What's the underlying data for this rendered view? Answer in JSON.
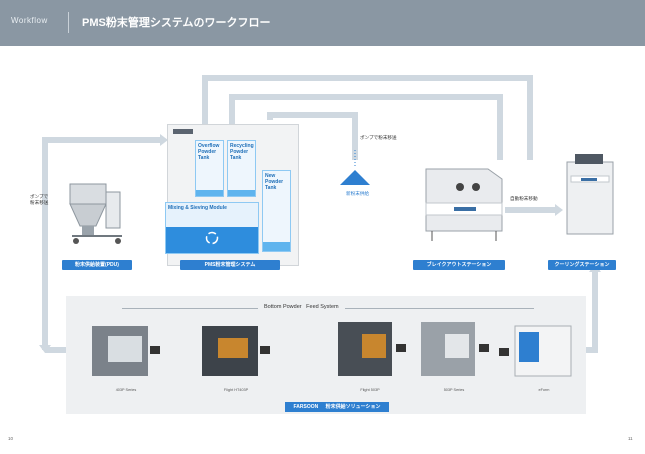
{
  "header": {
    "tag": "Workflow",
    "title": "PMS粉末管理システムのワークフロー"
  },
  "labels": {
    "pump_left": "ポンプで\n粉末移送",
    "pump_top": "ポンプで粉末移送",
    "pump_right": "自動粉末移動",
    "new_powder": "新粉末供給"
  },
  "tanks": {
    "overflow": "Overflow\nPowder\nTank",
    "recycling": "Recycling\nPowder\nTank",
    "new": "New\nPowder\nTank",
    "mixing": "Mixing & Sieving Module"
  },
  "stations": [
    "粉末供給装置(PDU)",
    "PMS粉末管理システム",
    "ブレイクアウトステーション",
    "クーリングステーション"
  ],
  "bottom": {
    "title": "Bottom Powder   Feed System",
    "footer_brand": "FARSOON",
    "footer_text": "粉末供給ソリューション",
    "machines": [
      "403P Series",
      "Flight HT403P",
      "Flight 503P",
      "503P Series",
      "eForm"
    ]
  },
  "page": {
    "left": "10",
    "right": "11"
  },
  "colors": {
    "header": "#8a97a3",
    "accent": "#2e7fd0",
    "arrow": "#cfd8e0"
  }
}
